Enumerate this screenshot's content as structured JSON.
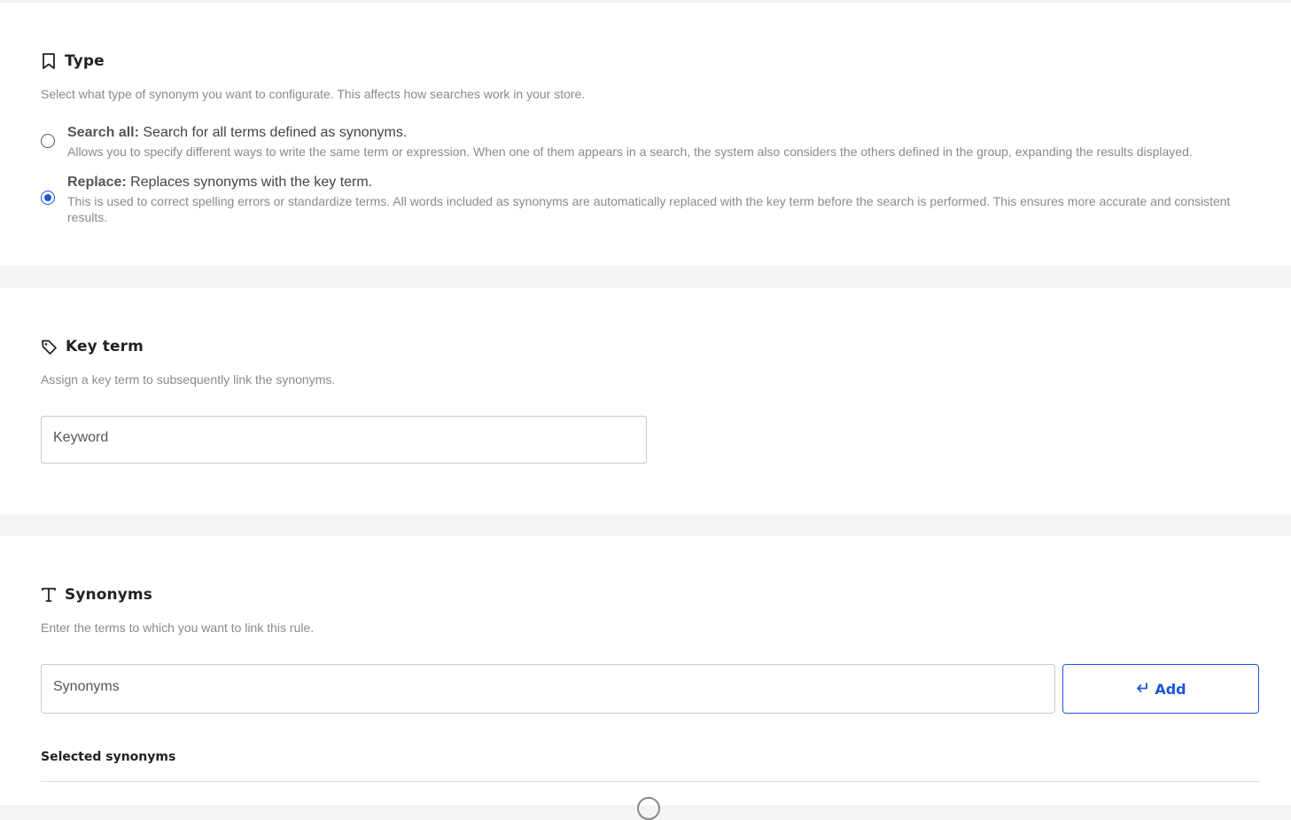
{
  "type_section": {
    "title": "Type",
    "icon": "bookmark-icon",
    "description": "Select what type of synonym you want to configurate. This affects how searches work in your store.",
    "options": [
      {
        "label_bold": "Search all:",
        "label_rest": " Search for all terms defined as synonyms.",
        "description": "Allows you to specify different ways to write the same term or expression. When one of them appears in a search, the system also considers the others defined in the group, expanding the results displayed.",
        "selected": false
      },
      {
        "label_bold": "Replace:",
        "label_rest": " Replaces synonyms with the key term.",
        "description": "This is used to correct spelling errors or standardize terms. All words included as synonyms are automatically replaced with the key term before the search is performed. This ensures more accurate and consistent results.",
        "selected": true
      }
    ]
  },
  "key_term_section": {
    "title": "Key term",
    "icon": "tag-icon",
    "description": "Assign a key term to subsequently link the synonyms.",
    "input": {
      "value": "",
      "placeholder": "Keyword"
    }
  },
  "synonyms_section": {
    "title": "Synonyms",
    "icon": "text-icon",
    "description": "Enter the terms to which you want to link this rule.",
    "input": {
      "value": "",
      "placeholder": "Synonyms"
    },
    "add_button": {
      "label": "Add",
      "icon": "enter-return-icon"
    },
    "selected_label": "Selected synonyms",
    "empty_icon": "info-circle-icon"
  },
  "colors": {
    "accent": "#1a56db",
    "muted_text": "#8a8a8a",
    "section_gap": "#f4f4f4"
  }
}
